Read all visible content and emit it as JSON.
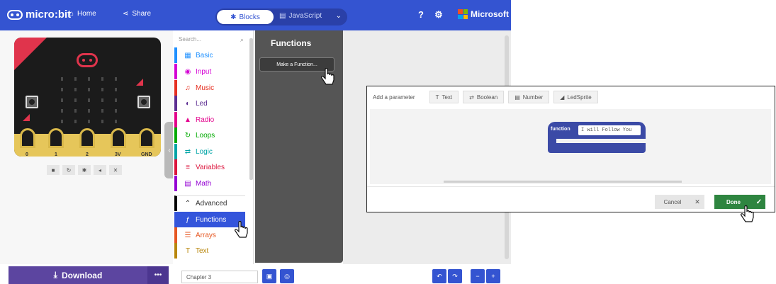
{
  "header": {
    "brand": "micro:bit",
    "home_label": "Home",
    "share_label": "Share",
    "blocks_label": "Blocks",
    "javascript_label": "JavaScript",
    "microsoft_label": "Microsoft",
    "accent": "#3454d1"
  },
  "simulator": {
    "pins": [
      "0",
      "1",
      "2",
      "3V",
      "GND"
    ]
  },
  "toolbox": {
    "search_placeholder": "Search...",
    "items": [
      {
        "label": "Basic",
        "color": "#1e90ff",
        "icon": "grid-icon",
        "glyph": "▦"
      },
      {
        "label": "Input",
        "color": "#d400d4",
        "icon": "input-icon",
        "glyph": "◉"
      },
      {
        "label": "Music",
        "color": "#e63022",
        "icon": "headphones-icon",
        "glyph": "♫"
      },
      {
        "label": "Led",
        "color": "#5c2d91",
        "icon": "toggle-icon",
        "glyph": "◐"
      },
      {
        "label": "Radio",
        "color": "#e3008c",
        "icon": "signal-icon",
        "glyph": "▲"
      },
      {
        "label": "Loops",
        "color": "#00aa00",
        "icon": "loop-icon",
        "glyph": "↻"
      },
      {
        "label": "Logic",
        "color": "#00a4a6",
        "icon": "shuffle-icon",
        "glyph": "⇄"
      },
      {
        "label": "Variables",
        "color": "#dc143c",
        "icon": "list-icon",
        "glyph": "≡"
      },
      {
        "label": "Math",
        "color": "#9400d3",
        "icon": "calculator-icon",
        "glyph": "▤"
      },
      {
        "label": "Advanced",
        "color": "#000000",
        "icon": "chevron-up-icon",
        "glyph": "⌃"
      },
      {
        "label": "Functions",
        "color": "#3455db",
        "icon": "function-icon",
        "glyph": "ƒ"
      },
      {
        "label": "Arrays",
        "color": "#e65722",
        "icon": "list-icon",
        "glyph": "☰"
      },
      {
        "label": "Text",
        "color": "#b8860b",
        "icon": "text-icon",
        "glyph": "T"
      }
    ]
  },
  "flyout": {
    "title": "Functions",
    "make_function": "Make a Function..."
  },
  "bottom": {
    "download_label": "Download",
    "project_name": "Chapter 3"
  },
  "dialog": {
    "add_param_label": "Add a parameter",
    "param_types": [
      "Text",
      "Boolean",
      "Number",
      "LedSprite"
    ],
    "function_keyword": "function",
    "function_name": "I will Follow You",
    "cancel_label": "Cancel",
    "done_label": "Done"
  }
}
